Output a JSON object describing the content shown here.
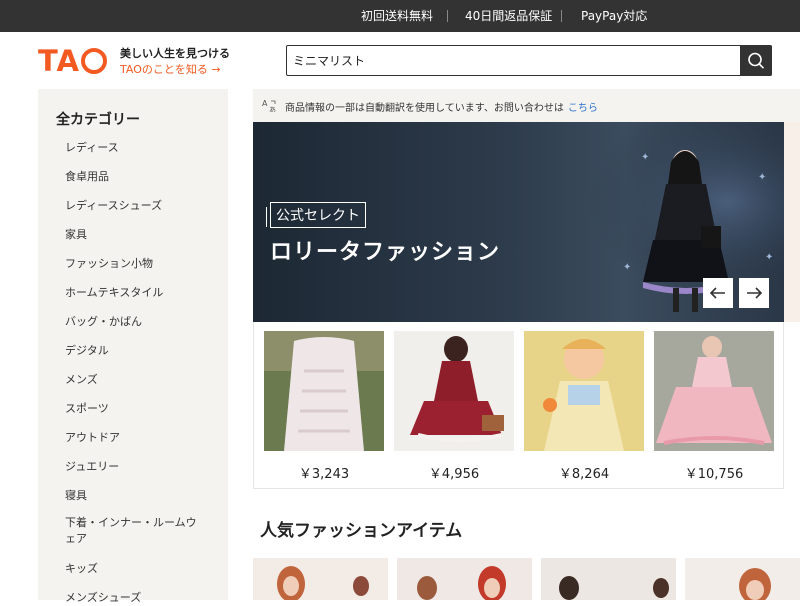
{
  "topbar": {
    "free_shipping": "初回送料無料",
    "returns": "40日間返品保証",
    "paypay": "PayPay対応"
  },
  "header": {
    "logo": "TAO",
    "tagline": "美しい人生を見つける",
    "about_link": "TAOのことを知る →",
    "search_value": "ミニマリスト"
  },
  "sidebar": {
    "title": "全カテゴリー",
    "items": [
      "レディース",
      "食卓用品",
      "レディースシューズ",
      "家具",
      "ファッション小物",
      "ホームテキスタイル",
      "バッグ・かばん",
      "デジタル",
      "メンズ",
      "スポーツ",
      "アウトドア",
      "ジュエリー",
      "寝具",
      "下着・インナー・ルームウェア",
      "キッズ",
      "メンズシューズ"
    ]
  },
  "notice": {
    "text": "商品情報の一部は自動翻訳を使用しています、お問い合わせは",
    "link": "こちら"
  },
  "banner": {
    "badge": "公式セレクト",
    "title": "ロリータファッション"
  },
  "products": [
    {
      "price": "￥3,243"
    },
    {
      "price": "￥4,956"
    },
    {
      "price": "￥8,264"
    },
    {
      "price": "￥10,756"
    }
  ],
  "popular": {
    "title": "人気ファッションアイテム"
  },
  "colors": {
    "accent": "#f25a22",
    "topbar": "#333333",
    "link": "#2a6fc9"
  }
}
